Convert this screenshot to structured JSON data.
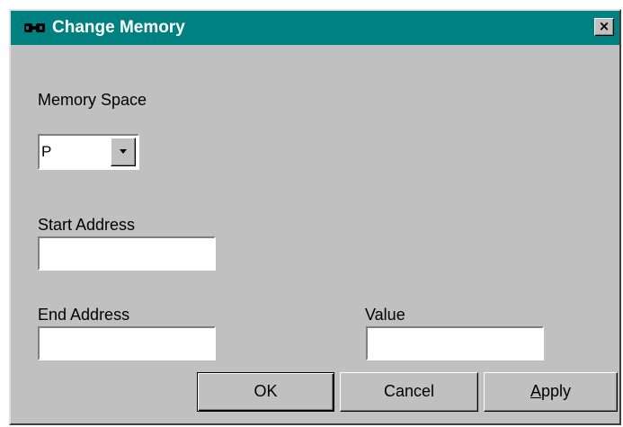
{
  "window": {
    "title": "Change Memory",
    "close_label": "×"
  },
  "memory_space": {
    "label": "Memory Space",
    "selected": "P"
  },
  "start_address": {
    "label": "Start Address",
    "value": ""
  },
  "end_address": {
    "label": "End Address",
    "value": ""
  },
  "value_field": {
    "label": "Value",
    "value": ""
  },
  "buttons": {
    "ok": "OK",
    "cancel": "Cancel",
    "apply_mnemonic": "A",
    "apply_rest": "pply"
  },
  "colors": {
    "titlebar": "#008080",
    "dialog_face": "#c0c0c0"
  }
}
